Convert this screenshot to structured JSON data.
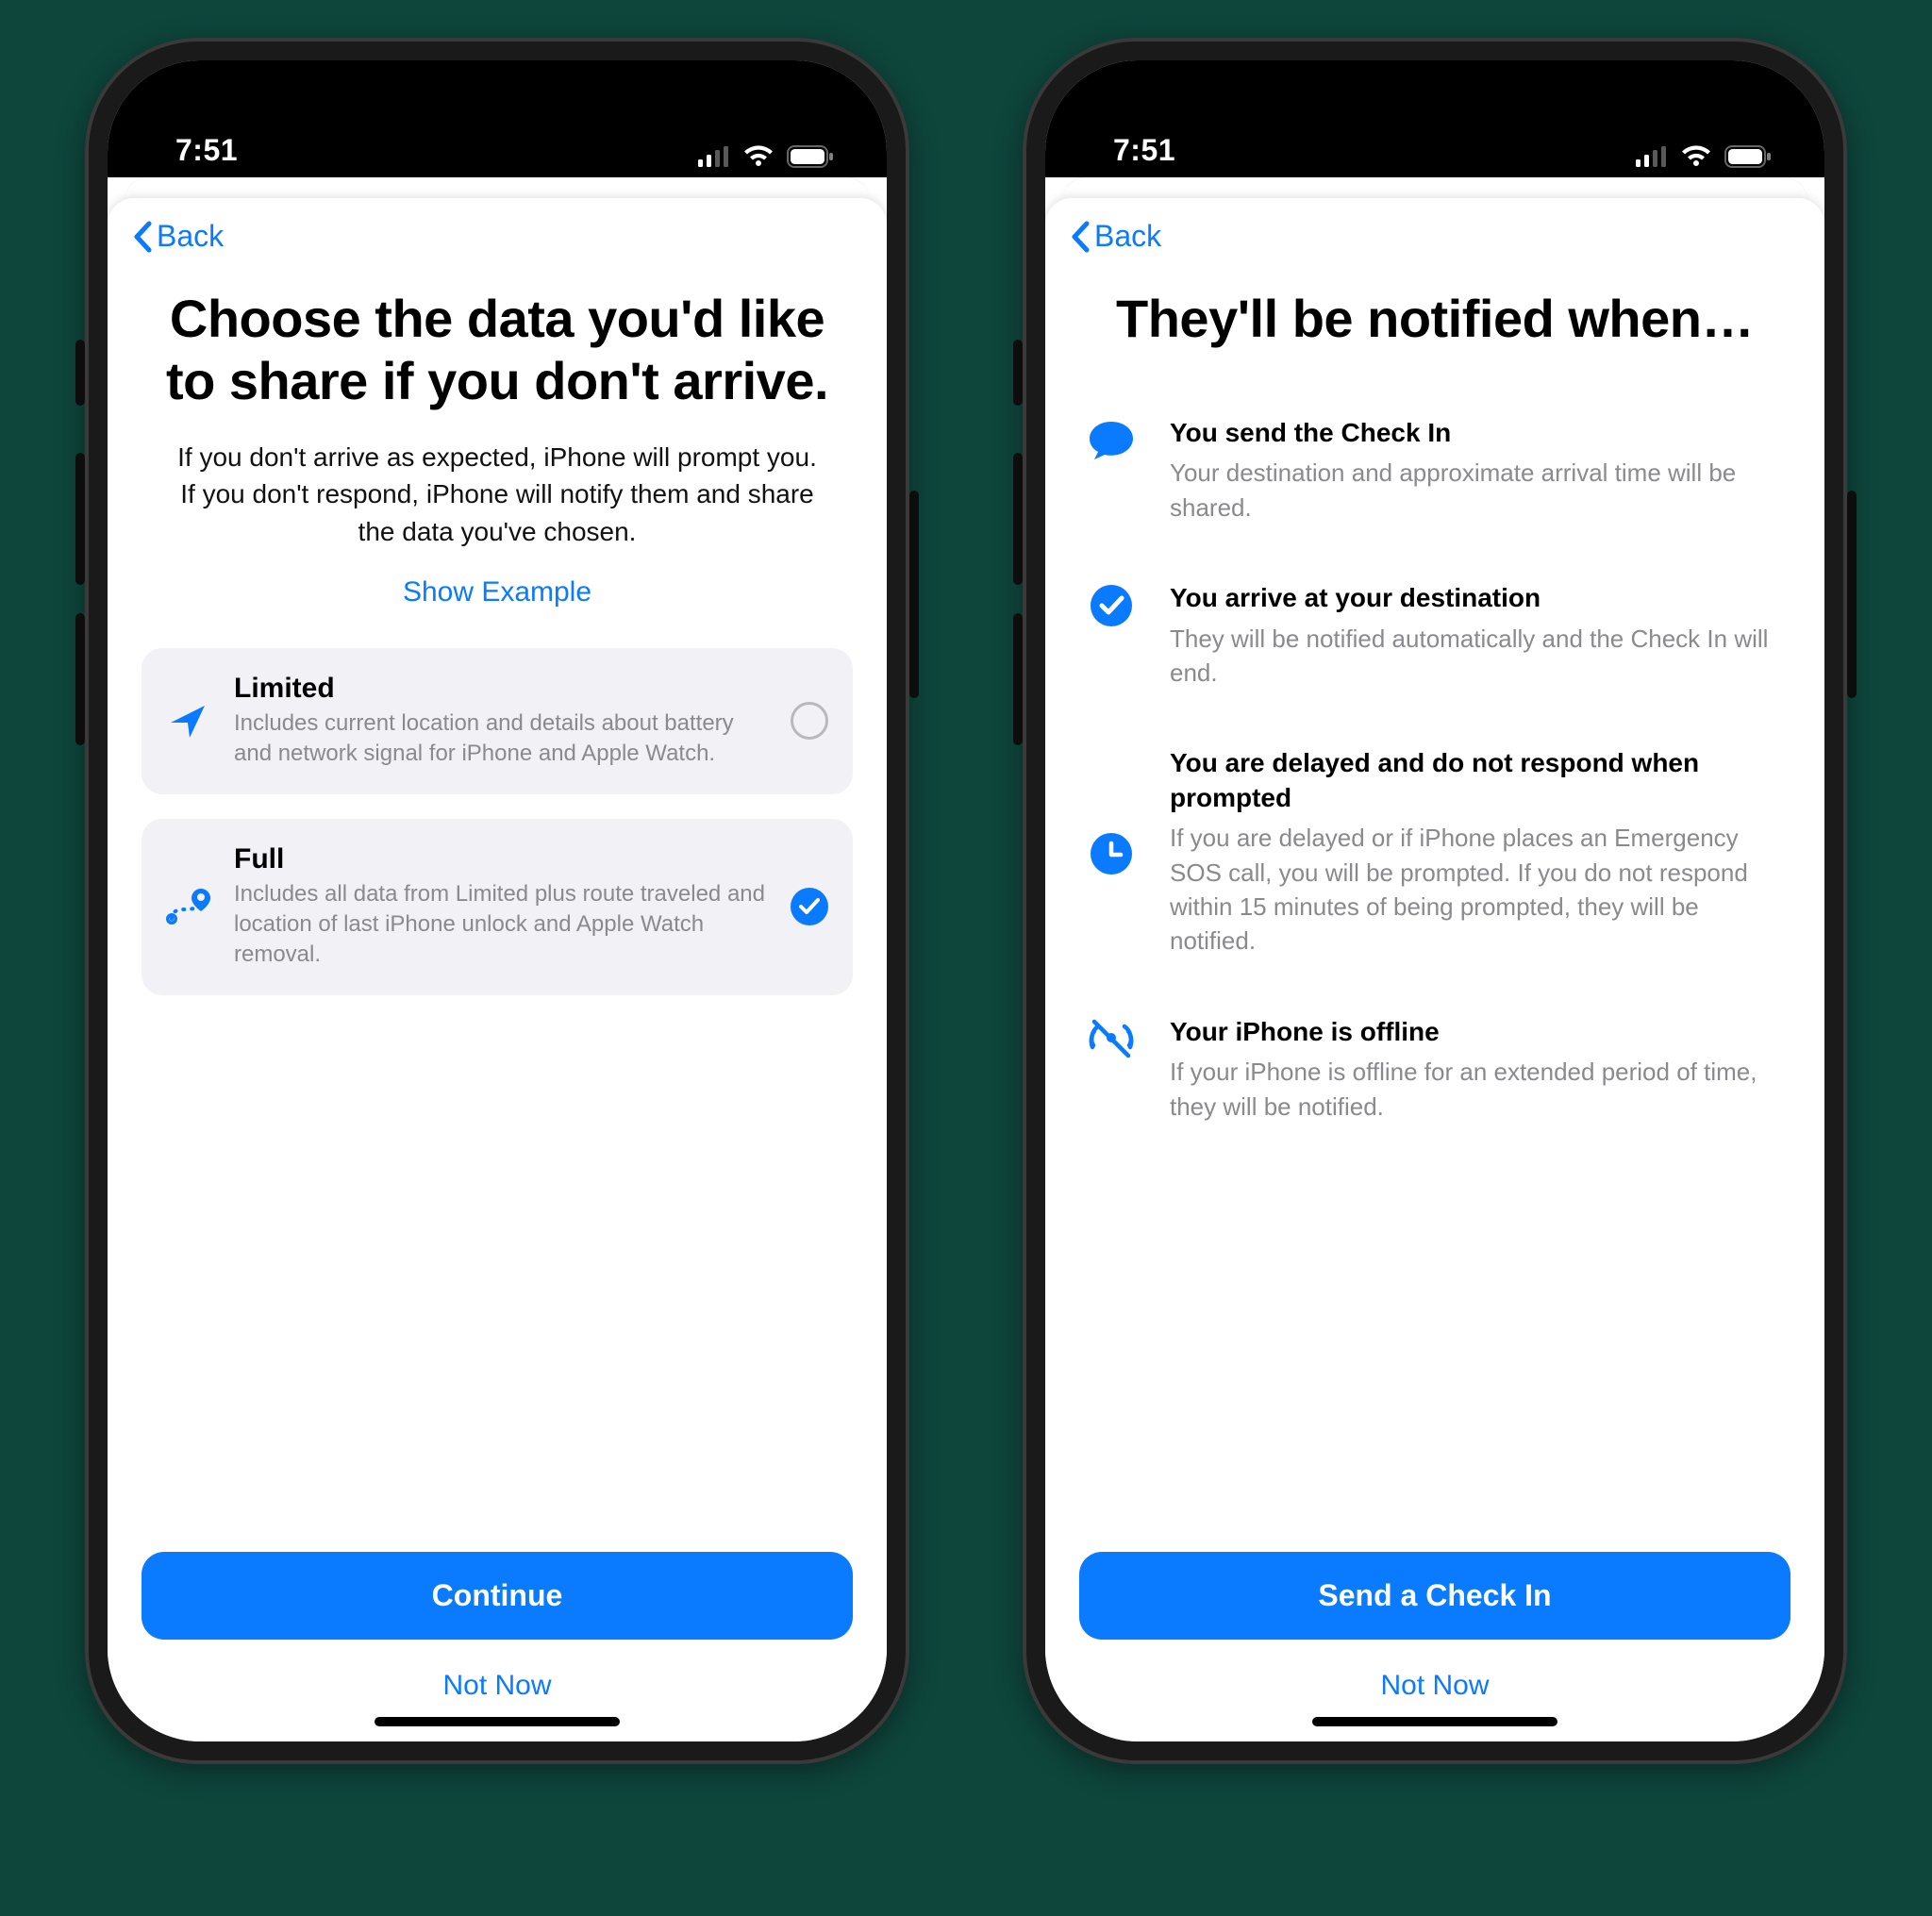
{
  "status": {
    "time": "7:51"
  },
  "nav": {
    "back_label": "Back"
  },
  "left_screen": {
    "title": "Choose the data you'd like to share if you don't arrive.",
    "subtitle": "If you don't arrive as expected, iPhone will prompt you. If you don't respond, iPhone will notify them and share the data you've chosen.",
    "show_example_label": "Show Example",
    "options": [
      {
        "title": "Limited",
        "desc": "Includes current location and details about battery and network signal for iPhone and Apple Watch.",
        "selected": false
      },
      {
        "title": "Full",
        "desc": "Includes all data from Limited plus route traveled and location of last iPhone unlock and Apple Watch removal.",
        "selected": true
      }
    ],
    "primary_label": "Continue",
    "secondary_label": "Not Now"
  },
  "right_screen": {
    "title": "They'll be notified when…",
    "items": [
      {
        "title": "You send the Check In",
        "desc": "Your destination and approximate arrival time will be shared."
      },
      {
        "title": "You arrive at your destination",
        "desc": "They will be notified automatically and the Check In will end."
      },
      {
        "title": "You are delayed and do not respond when prompted",
        "desc": "If you are delayed or if iPhone places an Emergency SOS call, you will be prompted. If you do not respond within 15 minutes of being prompted, they will be notified."
      },
      {
        "title": "Your iPhone is offline",
        "desc": "If your iPhone is offline for an extended period of time, they will be notified."
      }
    ],
    "primary_label": "Send a Check In",
    "secondary_label": "Not Now"
  }
}
